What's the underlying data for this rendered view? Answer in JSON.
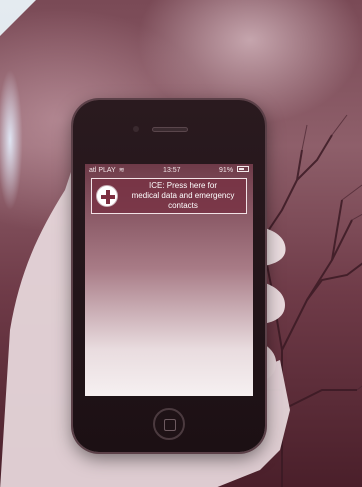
{
  "status_bar": {
    "carrier": "atl PLAY",
    "time": "13:57",
    "battery": "91%"
  },
  "ice_banner": {
    "text_line1": "ICE: Press here for",
    "text_line2": "medical data and emergency",
    "text_line3": "contacts"
  },
  "icons": {
    "medical": "medical-cross-icon",
    "wifi": "wifi-icon",
    "battery": "battery-icon"
  }
}
